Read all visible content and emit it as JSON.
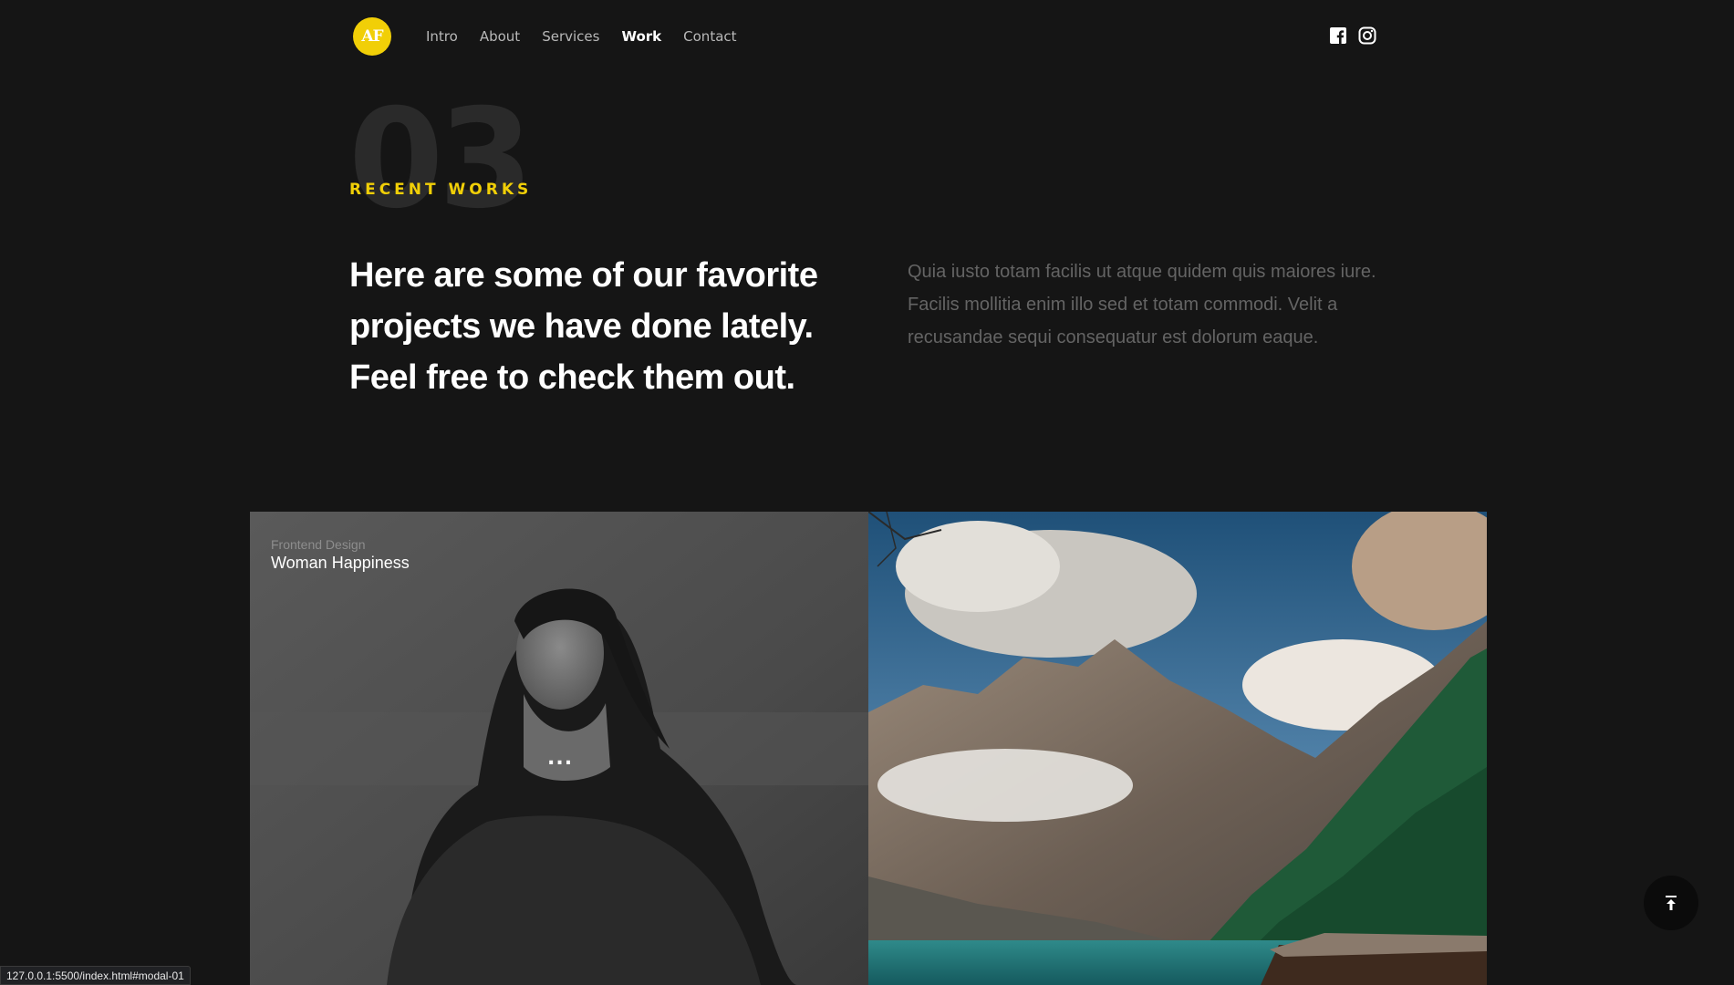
{
  "header": {
    "logo_text": "AF",
    "nav": [
      {
        "label": "Intro",
        "active": false
      },
      {
        "label": "About",
        "active": false
      },
      {
        "label": "Services",
        "active": false
      },
      {
        "label": "Work",
        "active": true
      },
      {
        "label": "Contact",
        "active": false
      }
    ],
    "social_icons": [
      "facebook-icon",
      "instagram-icon"
    ]
  },
  "section": {
    "number": "03",
    "kicker": "RECENT WORKS",
    "headline": "Here are some of our favorite projects we have done lately. Feel free to check them out.",
    "description": "Quia iusto totam facilis ut atque quidem quis maiores iure. Facilis mollitia enim illo sed et totam commodi. Velit a recusandae sequi consequatur est dolorum eaque."
  },
  "works": [
    {
      "category": "Frontend Design",
      "title": "Woman Happiness",
      "more": "..."
    },
    {
      "category": "",
      "title": ""
    }
  ],
  "back_to_top_icon": "arrow-up-to-line-icon",
  "status_bar": {
    "url": "127.0.0.1:5500/index.html#modal-01"
  },
  "colors": {
    "background": "#151515",
    "accent": "#f1cf07",
    "text": "#ffffff",
    "muted": "#646464"
  }
}
